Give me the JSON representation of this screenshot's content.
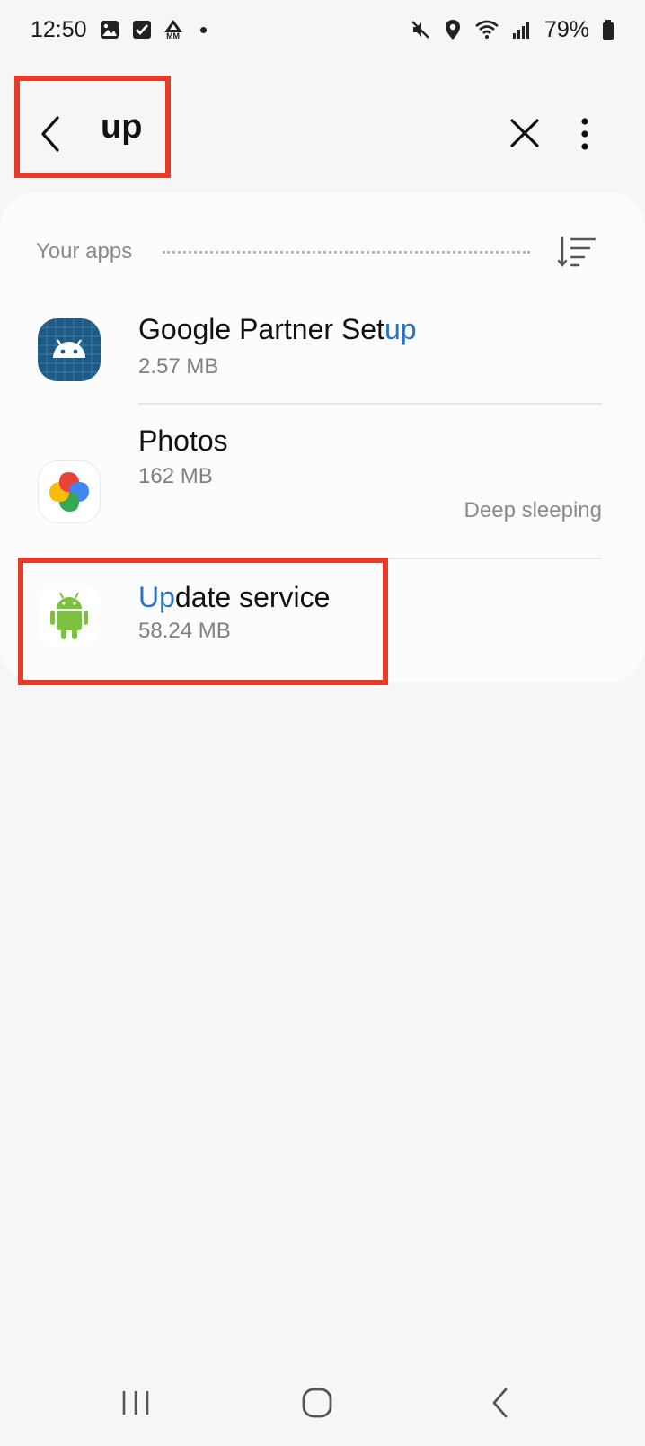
{
  "status_bar": {
    "time": "12:50",
    "battery": "79%",
    "left_icons": [
      "gallery-icon",
      "checkbox-icon",
      "mm-icon",
      "dot-icon"
    ],
    "right_icons": [
      "mute-icon",
      "location-icon",
      "wifi-icon",
      "signal-icon",
      "battery-icon"
    ],
    "mm_label": "MM"
  },
  "search": {
    "query": "up"
  },
  "section": {
    "title": "Your apps"
  },
  "apps": [
    {
      "name_prefix": "Google Partner Set",
      "name_highlight": "up",
      "name_suffix": "",
      "size": "2.57 MB",
      "status": ""
    },
    {
      "name_prefix": "Photos",
      "name_highlight": "",
      "name_suffix": "",
      "size": "162 MB",
      "status": "Deep sleeping"
    },
    {
      "name_prefix": "",
      "name_highlight": "Up",
      "name_suffix": "date service",
      "size": "58.24 MB",
      "status": ""
    }
  ],
  "colors": {
    "highlight_text": "#2a72c0",
    "annotation_box": "#e53b28",
    "background": "#f6f6f6"
  }
}
